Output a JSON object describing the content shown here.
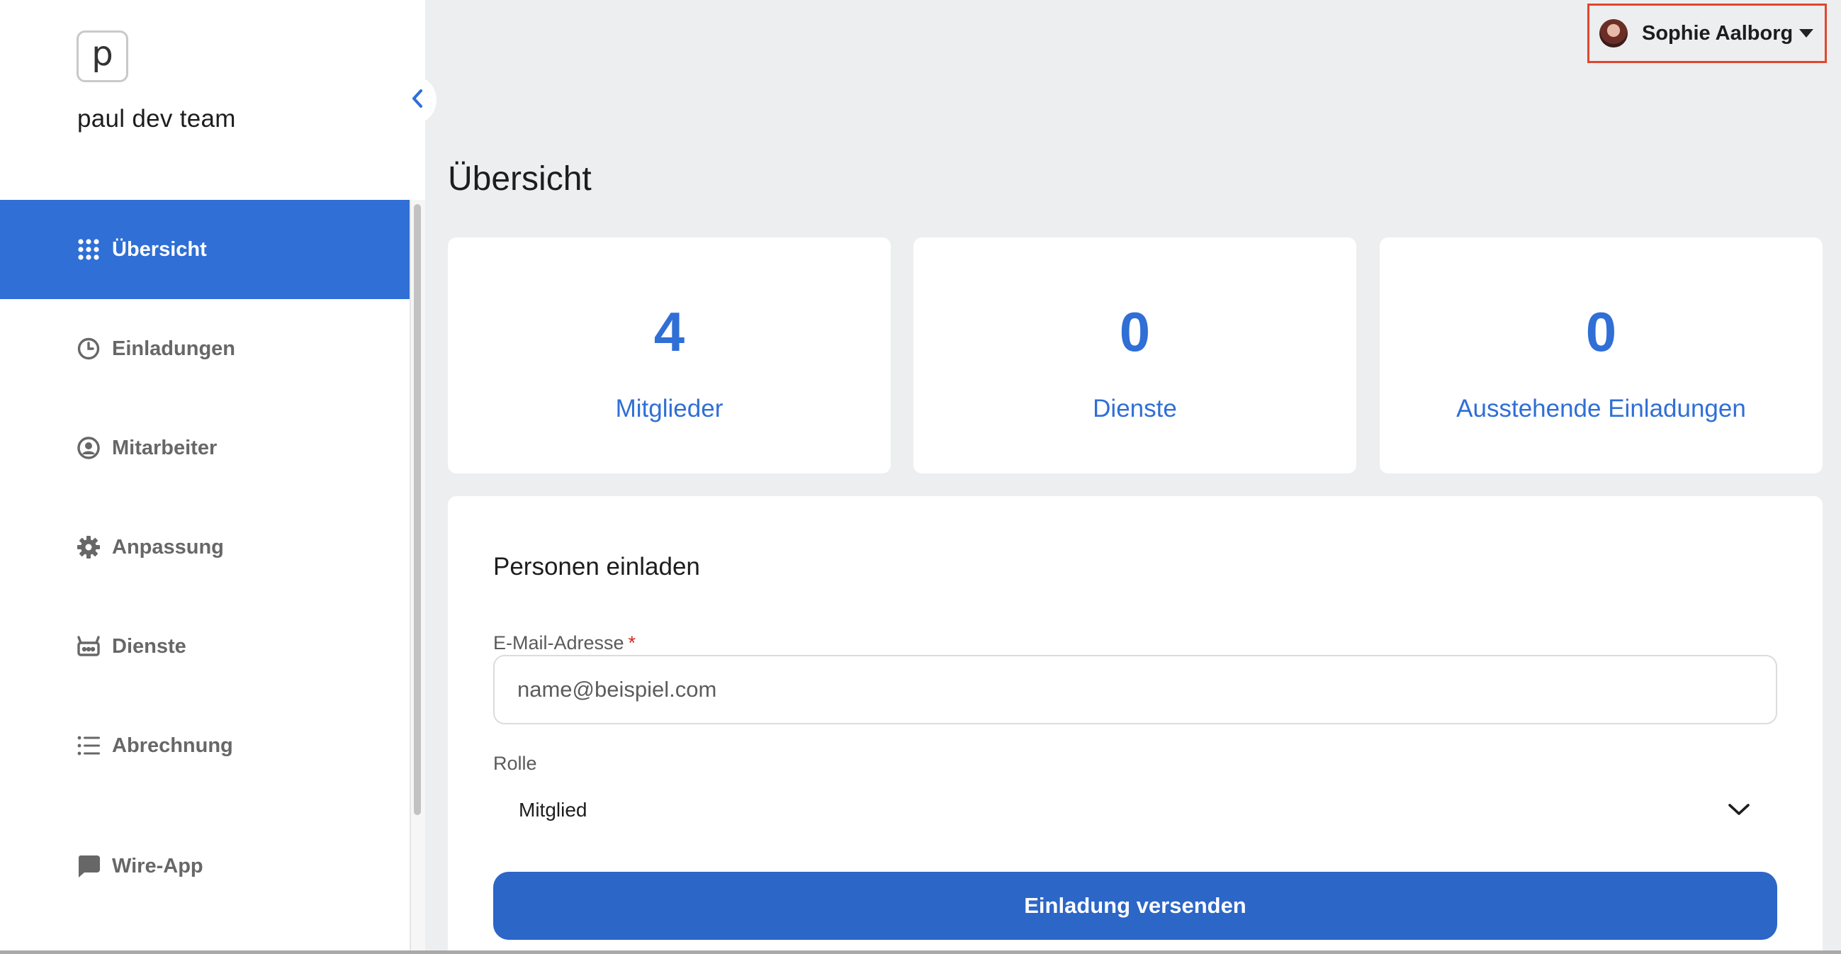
{
  "sidebar": {
    "logo_letter": "p",
    "team_name": "paul dev team",
    "items": [
      {
        "label": "Übersicht",
        "icon": "grid-icon",
        "active": true
      },
      {
        "label": "Einladungen",
        "icon": "clock-icon",
        "active": false
      },
      {
        "label": "Mitarbeiter",
        "icon": "user-circle-icon",
        "active": false
      },
      {
        "label": "Anpassung",
        "icon": "gear-icon",
        "active": false
      },
      {
        "label": "Dienste",
        "icon": "robot-icon",
        "active": false
      },
      {
        "label": "Abrechnung",
        "icon": "list-icon",
        "active": false
      },
      {
        "label": "Wire-App",
        "icon": "chat-bubble-icon",
        "active": false
      }
    ]
  },
  "header": {
    "user_name": "Sophie Aalborg"
  },
  "main": {
    "title": "Übersicht",
    "stats": [
      {
        "value": "4",
        "label": "Mitglieder"
      },
      {
        "value": "0",
        "label": "Dienste"
      },
      {
        "value": "0",
        "label": "Ausstehende Einladungen"
      }
    ],
    "invite": {
      "title": "Personen einladen",
      "email_label": "E-Mail-Adresse",
      "email_required_mark": "*",
      "email_placeholder": "name@beispiel.com",
      "role_label": "Rolle",
      "role_value": "Mitglied",
      "submit_label": "Einladung versenden"
    }
  },
  "colors": {
    "accent": "#2f6fd6",
    "button": "#2c66c7",
    "highlight_border": "#e0462f"
  }
}
